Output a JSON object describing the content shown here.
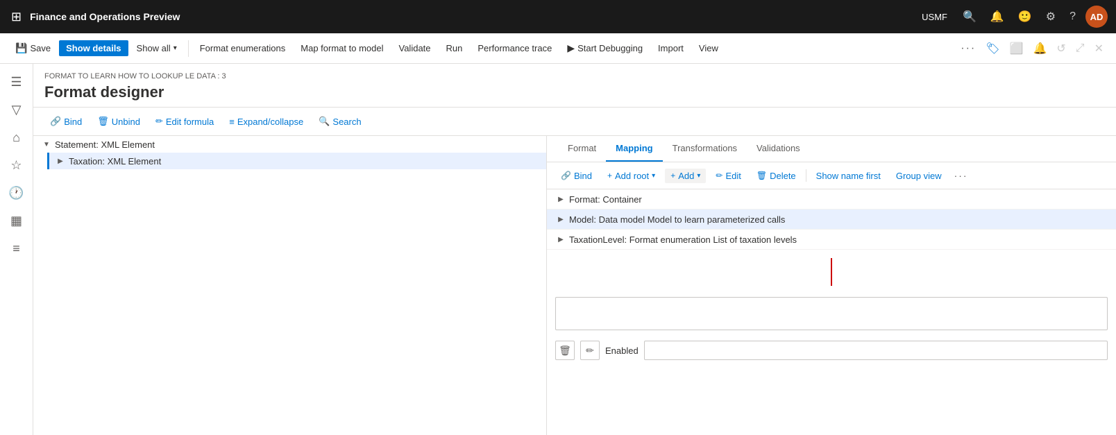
{
  "app": {
    "title": "Finance and Operations Preview",
    "user": "USMF",
    "avatar": "AD"
  },
  "commandBar": {
    "save": "Save",
    "showDetails": "Show details",
    "showAll": "Show all",
    "formatEnumerations": "Format enumerations",
    "mapFormatToModel": "Map format to model",
    "validate": "Validate",
    "run": "Run",
    "performanceTrace": "Performance trace",
    "startDebugging": "Start Debugging",
    "import": "Import",
    "view": "View"
  },
  "page": {
    "breadcrumb": "FORMAT TO LEARN HOW TO LOOKUP LE DATA : 3",
    "title": "Format designer"
  },
  "toolbar": {
    "bind": "Bind",
    "unbind": "Unbind",
    "editFormula": "Edit formula",
    "expandCollapse": "Expand/collapse",
    "search": "Search"
  },
  "tree": {
    "items": [
      {
        "id": "statement",
        "label": "Statement: XML Element",
        "level": 0,
        "expanded": true,
        "selected": false
      },
      {
        "id": "taxation",
        "label": "Taxation: XML Element",
        "level": 1,
        "expanded": false,
        "selected": true
      }
    ]
  },
  "tabs": [
    {
      "id": "format",
      "label": "Format"
    },
    {
      "id": "mapping",
      "label": "Mapping",
      "active": true
    },
    {
      "id": "transformations",
      "label": "Transformations"
    },
    {
      "id": "validations",
      "label": "Validations"
    }
  ],
  "mappingToolbar": {
    "bind": "Bind",
    "addRoot": "Add root",
    "add": "Add",
    "edit": "Edit",
    "delete": "Delete",
    "showNameFirst": "Show name first",
    "groupView": "Group view"
  },
  "dataSources": [
    {
      "id": "format-container",
      "label": "Format: Container",
      "expanded": false
    },
    {
      "id": "model-data",
      "label": "Model: Data model Model to learn parameterized calls",
      "expanded": false,
      "highlight": true
    },
    {
      "id": "taxation-level",
      "label": "TaxationLevel: Format enumeration List of taxation levels",
      "expanded": false
    }
  ],
  "bottom": {
    "enabledLabel": "Enabled",
    "inputPlaceholder": "",
    "enabledInputValue": ""
  },
  "leftNav": {
    "icons": [
      "home",
      "star",
      "clock",
      "calendar",
      "list"
    ]
  }
}
